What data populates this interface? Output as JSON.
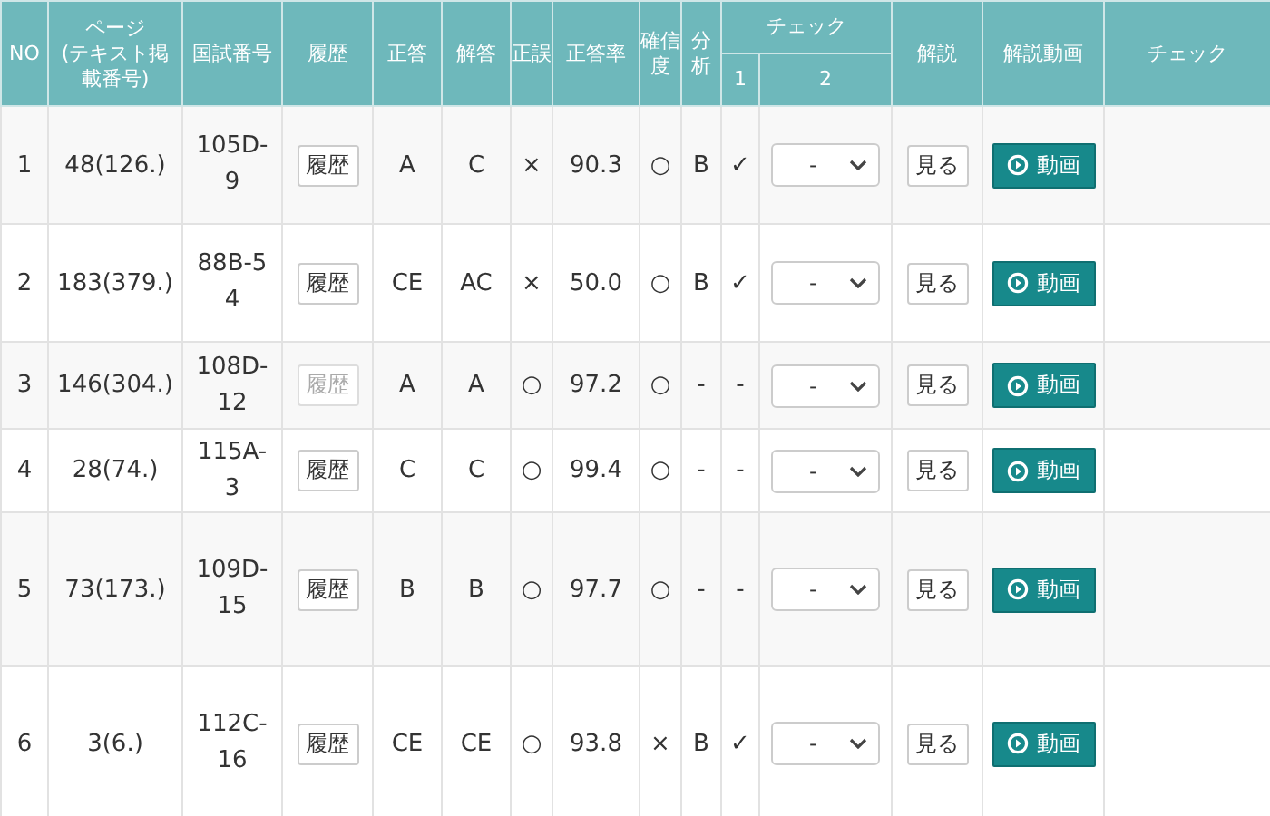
{
  "table": {
    "columns": [
      {
        "label": "NO"
      },
      {
        "label": "ページ\n(テキスト掲載番号)"
      },
      {
        "label": "国試番号"
      },
      {
        "label": "履歴"
      },
      {
        "label": "正答"
      },
      {
        "label": "解答"
      },
      {
        "label": "正誤"
      },
      {
        "label": "正答率"
      },
      {
        "label": "確信度"
      },
      {
        "label": "分析"
      },
      {
        "label": "チェック",
        "sub": [
          "1",
          "2"
        ]
      },
      {
        "label": "解説"
      },
      {
        "label": "解説動画"
      },
      {
        "label": "チェック"
      }
    ],
    "rows": [
      {
        "no": "1",
        "page": "48(126.)",
        "exam_no": "105D-9",
        "history": {
          "label": "履歴",
          "disabled": false
        },
        "correct": "A",
        "answer": "C",
        "result": "×",
        "rate": "90.3",
        "confidence": "○",
        "analysis": "B",
        "check1": "✓",
        "check2": "-",
        "explain": "見る",
        "video": "動画"
      },
      {
        "no": "2",
        "page": "183(379.)",
        "exam_no": "88B-54",
        "history": {
          "label": "履歴",
          "disabled": false
        },
        "correct": "CE",
        "answer": "AC",
        "result": "×",
        "rate": "50.0",
        "confidence": "○",
        "analysis": "B",
        "check1": "✓",
        "check2": "-",
        "explain": "見る",
        "video": "動画"
      },
      {
        "no": "3",
        "page": "146(304.)",
        "exam_no": "108D-12",
        "history": {
          "label": "履歴",
          "disabled": true
        },
        "correct": "A",
        "answer": "A",
        "result": "○",
        "rate": "97.2",
        "confidence": "○",
        "analysis": "-",
        "check1": "-",
        "check2": "-",
        "explain": "見る",
        "video": "動画"
      },
      {
        "no": "4",
        "page": "28(74.)",
        "exam_no": "115A-3",
        "history": {
          "label": "履歴",
          "disabled": false
        },
        "correct": "C",
        "answer": "C",
        "result": "○",
        "rate": "99.4",
        "confidence": "○",
        "analysis": "-",
        "check1": "-",
        "check2": "-",
        "explain": "見る",
        "video": "動画"
      },
      {
        "no": "5",
        "page": "73(173.)",
        "exam_no": "109D-15",
        "history": {
          "label": "履歴",
          "disabled": false
        },
        "correct": "B",
        "answer": "B",
        "result": "○",
        "rate": "97.7",
        "confidence": "○",
        "analysis": "-",
        "check1": "-",
        "check2": "-",
        "explain": "見る",
        "video": "動画"
      },
      {
        "no": "6",
        "page": "3(6.)",
        "exam_no": "112C-16",
        "history": {
          "label": "履歴",
          "disabled": false
        },
        "correct": "CE",
        "answer": "CE",
        "result": "○",
        "rate": "93.8",
        "confidence": "×",
        "analysis": "B",
        "check1": "✓",
        "check2": "-",
        "explain": "見る",
        "video": "動画"
      }
    ]
  }
}
